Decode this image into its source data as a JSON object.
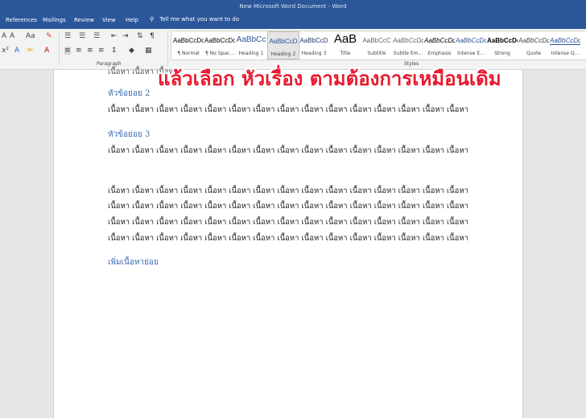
{
  "window": {
    "title": "New Microsoft Word Document  -  Word"
  },
  "tabs": [
    "References",
    "Mailings",
    "Review",
    "View",
    "Help"
  ],
  "tell_me": "Tell me what you want to do",
  "groups": {
    "paragraph": "Paragraph",
    "styles": "Styles"
  },
  "styles_gallery": [
    {
      "preview": "AaBbCcDc",
      "name": "¶ Normal"
    },
    {
      "preview": "AaBbCcDc",
      "name": "¶ No Spac..."
    },
    {
      "preview": "AaBbCc",
      "name": "Heading 1"
    },
    {
      "preview": "AaBbCcD",
      "name": "Heading 2",
      "selected": true
    },
    {
      "preview": "AaBbCcD",
      "name": "Heading 3"
    },
    {
      "preview": "AaB",
      "name": "Title"
    },
    {
      "preview": "AaBbCcC",
      "name": "Subtitle"
    },
    {
      "preview": "AaBbCcDc",
      "name": "Subtle Em..."
    },
    {
      "preview": "AaBbCcDc",
      "name": "Emphasis"
    },
    {
      "preview": "AaBbCcDc",
      "name": "Intense E..."
    },
    {
      "preview": "AaBbCcDc",
      "name": "Strong"
    },
    {
      "preview": "AaBbCcDc",
      "name": "Quote"
    },
    {
      "preview": "AaBbCcDc",
      "name": "Intense Q..."
    }
  ],
  "overlay_text": "แล้วเลือก หัวเรื่อง ตามต้องการเหมือนเดิม",
  "document": {
    "partial_line": "เนื้อหา เนื้อหา เนื้อหา",
    "heading_2": "หัวข้อย่อย 2",
    "body_a": "เนื้อหา เนื้อหา เนื้อหา  เนื้อหา เนื้อหา เนื้อหา เนื้อหา เนื้อหา เนื้อหา  เนื้อหา เนื้อหา เนื้อหา เนื้อหา เนื้อหา เนื้อหา",
    "heading_3": "หัวข้อย่อย 3",
    "body_b": "เนื้อหา เนื้อหา เนื้อหา  เนื้อหา เนื้อหา เนื้อหา เนื้อหา เนื้อหา เนื้อหา  เนื้อหา เนื้อหา เนื้อหา เนื้อหา เนื้อหา เนื้อหา",
    "para": [
      "เนื้อหา เนื้อหา เนื้อหา  เนื้อหา เนื้อหา เนื้อหา เนื้อหา เนื้อหา เนื้อหา  เนื้อหา เนื้อหา เนื้อหา เนื้อหา เนื้อหา เนื้อหา",
      "เนื้อหา เนื้อหา เนื้อหา เนื้อหา เนื้อหา  เนื้อหา เนื้อหา เนื้อหา เนื้อหา เนื้อหา เนื้อหา  เนื้อหา เนื้อหา เนื้อหา เนื้อหา",
      "เนื้อหา เนื้อหา  เนื้อหา เนื้อหา เนื้อหา เนื้อหา เนื้อหา เนื้อหา  เนื้อหา เนื้อหา เนื้อหา เนื้อหา เนื้อหา  เนื้อหา เนื้อหา",
      "เนื้อหา เนื้อหา เนื้อหา  เนื้อหา เนื้อหา เนื้อหา เนื้อหา เนื้อหา เนื้อหา  เนื้อหา เนื้อหา เนื้อหา เนื้อหา เนื้อหา เนื้อหา"
    ],
    "new_heading": "เพิ่มเนื้อหาย่อย"
  },
  "accent_color": "#2b579a",
  "heading_color": "#3c6ab3",
  "overlay_color": "#e8192e"
}
